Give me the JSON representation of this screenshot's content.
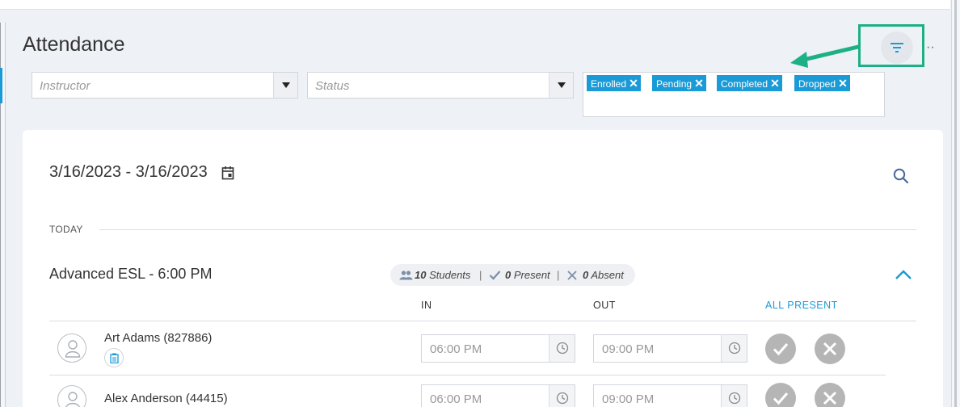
{
  "page": {
    "title": "Attendance"
  },
  "filters": {
    "instructor_placeholder": "Instructor",
    "status_placeholder": "Status",
    "tags": [
      "Enrolled",
      "Pending",
      "Completed",
      "Dropped"
    ],
    "more_glyph": "··"
  },
  "card": {
    "date_range": "3/16/2023 - 3/16/2023",
    "section_label": "TODAY",
    "class_name": "Advanced ESL - 6:00 PM",
    "summary": {
      "students_count": "10",
      "students_label": "Students",
      "present_count": "0",
      "present_label": "Present",
      "absent_count": "0",
      "absent_label": "Absent",
      "sep": "|"
    },
    "columns": {
      "in": "IN",
      "out": "OUT",
      "all_present": "ALL PRESENT"
    },
    "students": [
      {
        "name": "Art Adams (827886)",
        "in": "06:00 PM",
        "out": "09:00 PM"
      },
      {
        "name": "Alex Anderson (44415)",
        "in": "06:00 PM",
        "out": "09:00 PM"
      }
    ]
  },
  "colors": {
    "accent": "#1a9bd7",
    "highlight": "#1db087",
    "mark": "#b5b5b5"
  }
}
